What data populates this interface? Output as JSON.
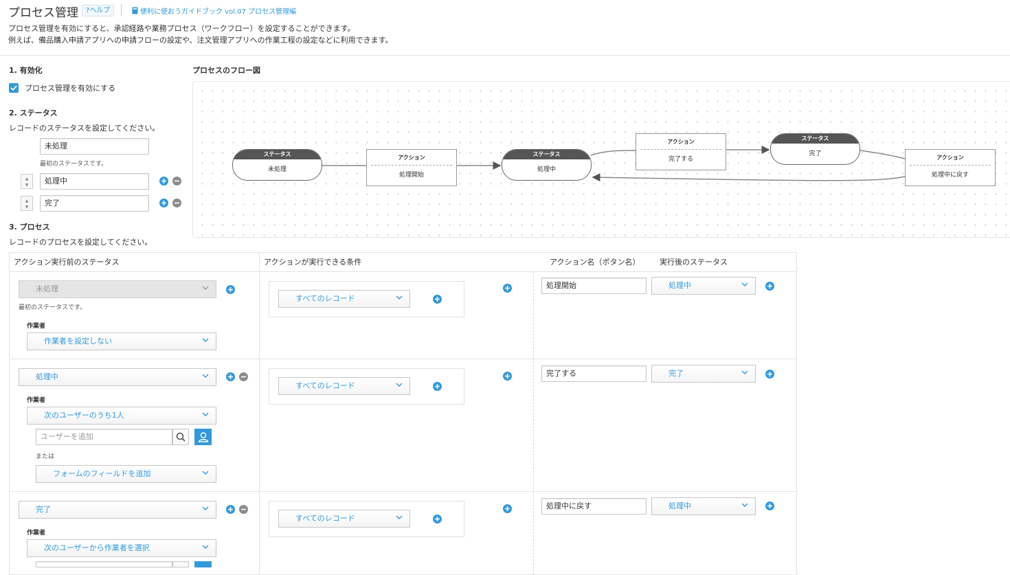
{
  "header": {
    "title": "プロセス管理",
    "help_label": "ヘルプ",
    "guide_link": "便利に使おうガイドブック vol.07 プロセス管理編"
  },
  "description": {
    "line1": "プロセス管理を有効にすると、承認経路や業務プロセス（ワークフロー）を設定することができます。",
    "line2": "例えば、備品購入申請アプリへの申請フローの設定や、注文管理アプリへの作業工程の設定などに利用できます。"
  },
  "section1": {
    "heading": "1. 有効化",
    "checkbox_label": "プロセス管理を有効にする",
    "checked": true
  },
  "section2": {
    "heading": "2. ステータス",
    "instruction": "レコードのステータスを設定してください。",
    "first_status": "未処理",
    "first_note": "最初のステータスです。",
    "statuses": [
      "処理中",
      "完了"
    ]
  },
  "section3": {
    "heading": "3. プロセス",
    "instruction": "レコードのプロセスを設定してください。",
    "columns": {
      "before": "アクション実行前のステータス",
      "condition": "アクションが実行できる条件",
      "action_name": "アクション名（ボタン名）",
      "after": "実行後のステータス"
    },
    "assignee_label": "作業者",
    "first_note": "最初のステータスです。",
    "user_placeholder": "ユーザーを追加",
    "or_label": "または",
    "rows": [
      {
        "status": "未処理",
        "assignee": "作業者を設定しない",
        "condition": "すべてのレコード",
        "action": "処理開始",
        "next": "処理中"
      },
      {
        "status": "処理中",
        "assignee": "次のユーザーのうち1人",
        "field_select": "フォームのフィールドを追加",
        "condition": "すべてのレコード",
        "action": "完了する",
        "next": "完了"
      },
      {
        "status": "完了",
        "assignee": "次のユーザーから作業者を選択",
        "condition": "すべてのレコード",
        "action": "処理中に戻す",
        "next": "処理中"
      }
    ]
  },
  "flow": {
    "title": "プロセスのフロー図",
    "status_header": "ステータス",
    "action_header": "アクション",
    "nodes": {
      "s1": "未処理",
      "a1": "処理開始",
      "s2": "処理中",
      "a2": "完了する",
      "s3": "完了",
      "a3": "処理中に戻す"
    }
  },
  "colors": {
    "accent": "#3498db",
    "node_header": "#555555"
  },
  "icons": [
    "help-icon",
    "book-icon",
    "check-icon",
    "plus-icon",
    "minus-icon",
    "chevron-down-icon",
    "search-icon",
    "user-icon"
  ]
}
